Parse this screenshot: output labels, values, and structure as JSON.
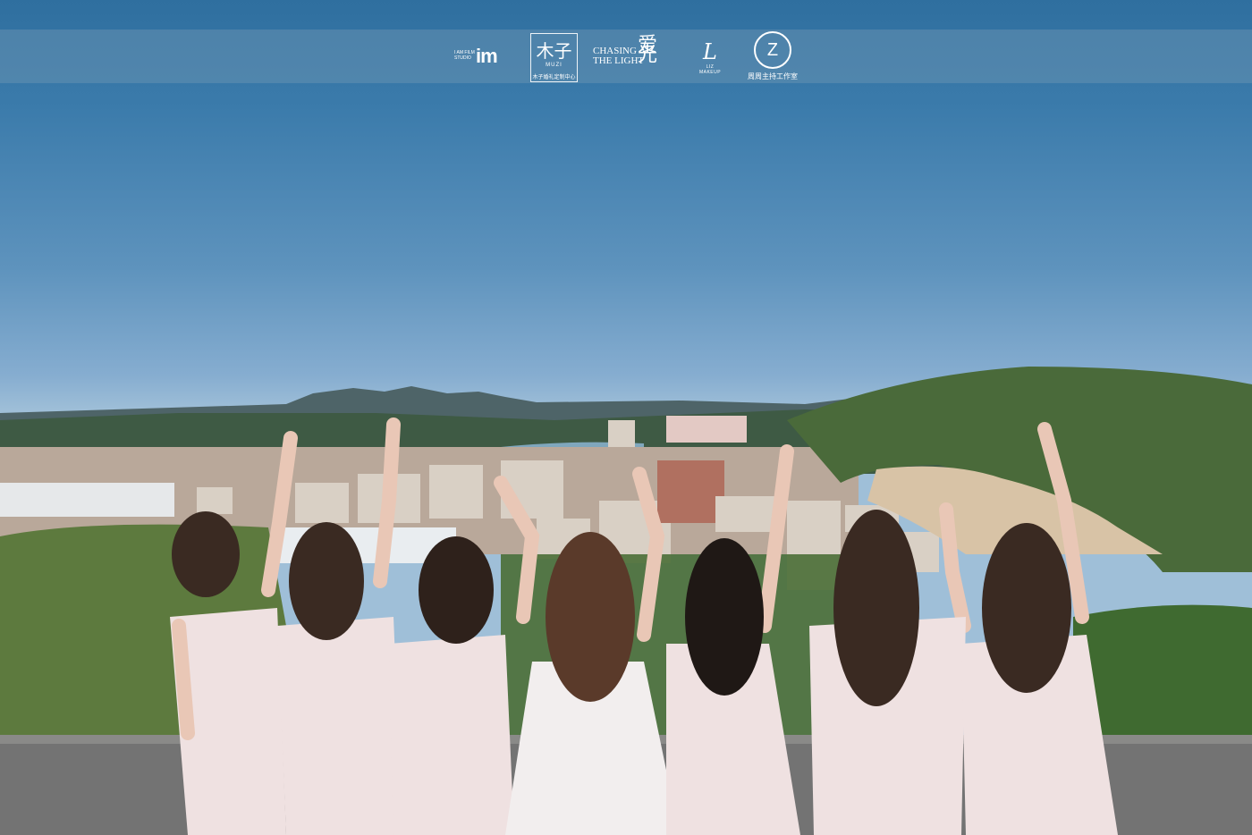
{
  "logos": {
    "im": {
      "text_small": "I AM FILM STUDIO",
      "text_big": "im"
    },
    "muzi": {
      "mark": "木子",
      "name": "MUZI",
      "sub": "木子婚礼定制中心"
    },
    "chasing": {
      "line1": "CHASING",
      "line2": "THE LIGHT",
      "mark": "爱光"
    },
    "liz": {
      "mark": "L",
      "name": "LIZ MAKEUP"
    },
    "zhouzhou": {
      "mark": "Z",
      "name": "周周主持工作室"
    }
  },
  "colors": {
    "sky_top": "#2f6f9f",
    "sky_horizon": "#9fbfd8",
    "dress": "#efe2e2",
    "hair": "#3a2a22"
  }
}
